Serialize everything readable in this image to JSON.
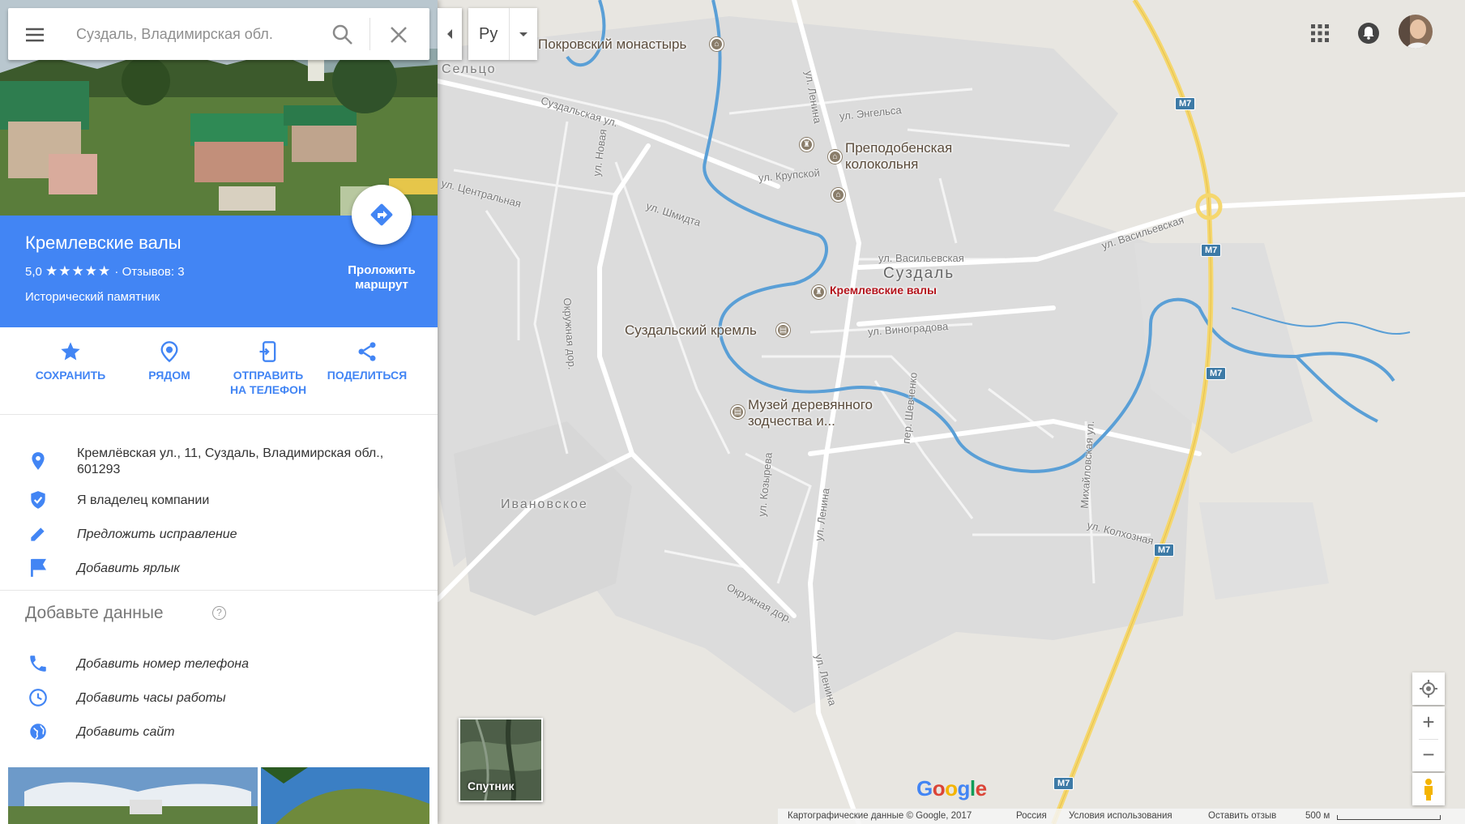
{
  "search": {
    "placeholder": "Суздаль, Владимирская обл.",
    "language": "Ру"
  },
  "place": {
    "title": "Кремлевские валы",
    "rating": "5,0",
    "stars": "★★★★★",
    "reviews": "· Отзывов: 3",
    "category": "Исторический памятник",
    "route_label_1": "Проложить",
    "route_label_2": "маршрут"
  },
  "actions": [
    {
      "label": "СОХРАНИТЬ",
      "icon": "star-icon"
    },
    {
      "label": "РЯДОМ",
      "icon": "nearby-icon"
    },
    {
      "label_1": "ОТПРАВИТЬ",
      "label_2": "НА ТЕЛЕФОН",
      "icon": "send-to-phone-icon"
    },
    {
      "label": "ПОДЕЛИТЬСЯ",
      "icon": "share-icon"
    }
  ],
  "info": {
    "address_1": "Кремлёвская ул., 11, Суздаль, Владимирская обл.,",
    "address_2": "601293",
    "owner": "Я владелец компании",
    "suggest": "Предложить исправление",
    "label": "Добавить ярлык"
  },
  "add_data": {
    "title": "Добавьте данные",
    "help": "?",
    "phone": "Добавить номер телефона",
    "hours": "Добавить часы работы",
    "site": "Добавить сайт"
  },
  "map": {
    "pin_label": "Кремлевские валы",
    "places": {
      "pokrovsky": "Покровский монастырь",
      "bell_1": "Преподобенская",
      "bell_2": "колокольня",
      "kremlin": "Суздальский кремль",
      "museum_1": "Музей деревянного",
      "museum_2": "зодчества и..."
    },
    "city": "Суздаль",
    "districts": {
      "seltso": "Сельцо",
      "ivanovskoe": "Ивановское"
    },
    "streets": {
      "suzdalskaya": "Суздальская ул.",
      "lenina_top": "ул. Ленина",
      "engelsa": "ул. Энгельса",
      "novaya": "ул. Новая",
      "krupskoy": "ул. Крупской",
      "tsentralnaya": "ул. Центральная",
      "shmidta": "ул. Шмидта",
      "vasilevskaya": "ул. Васильевская",
      "vasilevskaya_east": "ул. Васильевская",
      "vinogradova": "ул. Виноградова",
      "okruzhnaya_left": "Окружная дор.",
      "okruzhnaya_bottom": "Окружная дор.",
      "shevchenko": "пер. Шевченко",
      "kozyreva": "ул. Козырева",
      "lenina_mid": "ул. Ленина",
      "lenina_bottom": "ул. Ленина",
      "mikhailovskaya": "Михайловская ул.",
      "kolkhoznaya": "ул. Колхозная"
    },
    "highway": "M7",
    "satellite_label": "Спутник"
  },
  "controls": {
    "zoom_in": "+",
    "zoom_out": "−"
  },
  "logo": {
    "g": "G",
    "o1": "o",
    "o2": "o",
    "g2": "g",
    "l": "l",
    "e": "e"
  },
  "footer": {
    "copyright": "Картографические данные © Google, 2017",
    "country": "Россия",
    "terms": "Условия использования",
    "feedback": "Оставить отзыв",
    "scale": "500 м"
  },
  "colors": {
    "accent": "#4285f4",
    "map_bg": "#e5e3df",
    "urban": "#dedede",
    "river": "#5a9fd6",
    "highway": "#f5d76e",
    "pin": "#db4437"
  }
}
